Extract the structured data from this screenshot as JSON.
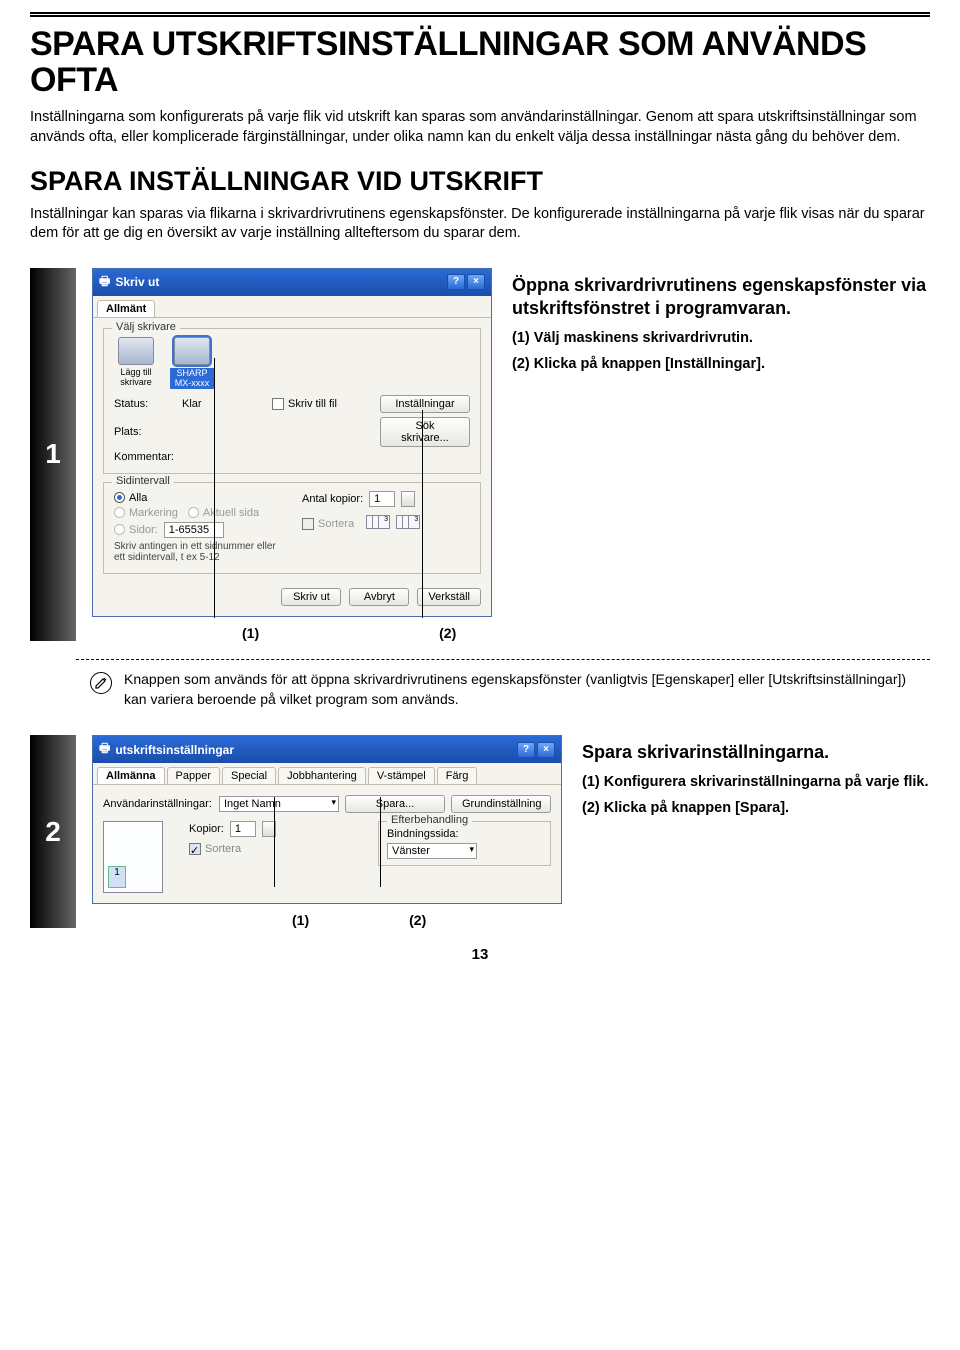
{
  "page_number": "13",
  "h1": "SPARA UTSKRIFTSINSTÄLLNINGAR SOM ANVÄNDS OFTA",
  "intro": "Inställningarna som konfigurerats på varje flik vid utskrift kan sparas som användarinställningar. Genom att spara utskriftsinställningar som används ofta, eller komplicerade färginställningar, under olika namn kan du enkelt välja dessa inställningar nästa gång du behöver dem.",
  "h2": "SPARA INSTÄLLNINGAR VID UTSKRIFT",
  "sub": "Inställningar kan sparas via flikarna i skrivardrivrutinens egenskapsfönster. De konfigurerade inställningarna på varje flik visas när du sparar dem för att ge dig en översikt av varje inställning allteftersom du sparar dem.",
  "step1": {
    "num": "1",
    "heading": "Öppna skrivardrivrutinens egenskapsfönster via utskriftsfönstret i programvaran.",
    "l1": "(1)  Välj maskinens skrivardrivrutin.",
    "l2": "(2)  Klicka på knappen [Inställningar].",
    "c1": "(1)",
    "c2": "(2)",
    "dialog": {
      "title": "Skriv ut",
      "help": "?",
      "close": "×",
      "tab": "Allmänt",
      "g_select": "Välj skrivare",
      "add": "Lägg till skrivare",
      "sharp": "SHARP MX-xxxx",
      "status_l": "Status:",
      "status_v": "Klar",
      "plats_l": "Plats:",
      "komm_l": "Kommentar:",
      "chk_file": "Skriv till fil",
      "btn_settings": "Inställningar",
      "btn_search": "Sök skrivare...",
      "g_range": "Sidintervall",
      "r_alla": "Alla",
      "r_mark": "Markering",
      "r_akt": "Aktuell sida",
      "r_pages": "Sidor:",
      "range_v": "1-65535",
      "range_hint": "Skriv antingen in ett sidnummer eller ett sidintervall, t ex 5-12",
      "copies_l": "Antal kopior:",
      "copies_v": "1",
      "sortera": "Sortera",
      "btn_print": "Skriv ut",
      "btn_cancel": "Avbryt",
      "btn_apply": "Verkställ"
    }
  },
  "note": "Knappen som används för att öppna skrivardrivrutinens egenskapsfönster (vanligtvis [Egenskaper] eller [Utskriftsinställningar]) kan variera beroende på vilket program som används.",
  "step2": {
    "num": "2",
    "heading": "Spara skrivarinställningarna.",
    "l1": "(1)  Konfigurera skrivarinställningarna på varje flik.",
    "l2": "(2)  Klicka på knappen [Spara].",
    "c1": "(1)",
    "c2": "(2)",
    "dialog": {
      "title": "utskriftsinställningar",
      "help": "?",
      "close": "×",
      "tabs": [
        "Allmänna",
        "Papper",
        "Special",
        "Jobbhantering",
        "V-stämpel",
        "Färg"
      ],
      "user_l": "Användarinställningar:",
      "user_v": "Inget Namn",
      "btn_save": "Spara...",
      "btn_default": "Grundinställning",
      "kopior_l": "Kopior:",
      "kopior_v": "1",
      "sortera": "Sortera",
      "efter_l": "Efterbehandling",
      "bind_l": "Bindningssida:",
      "bind_v": "Vänster",
      "preview_n": "1"
    }
  }
}
